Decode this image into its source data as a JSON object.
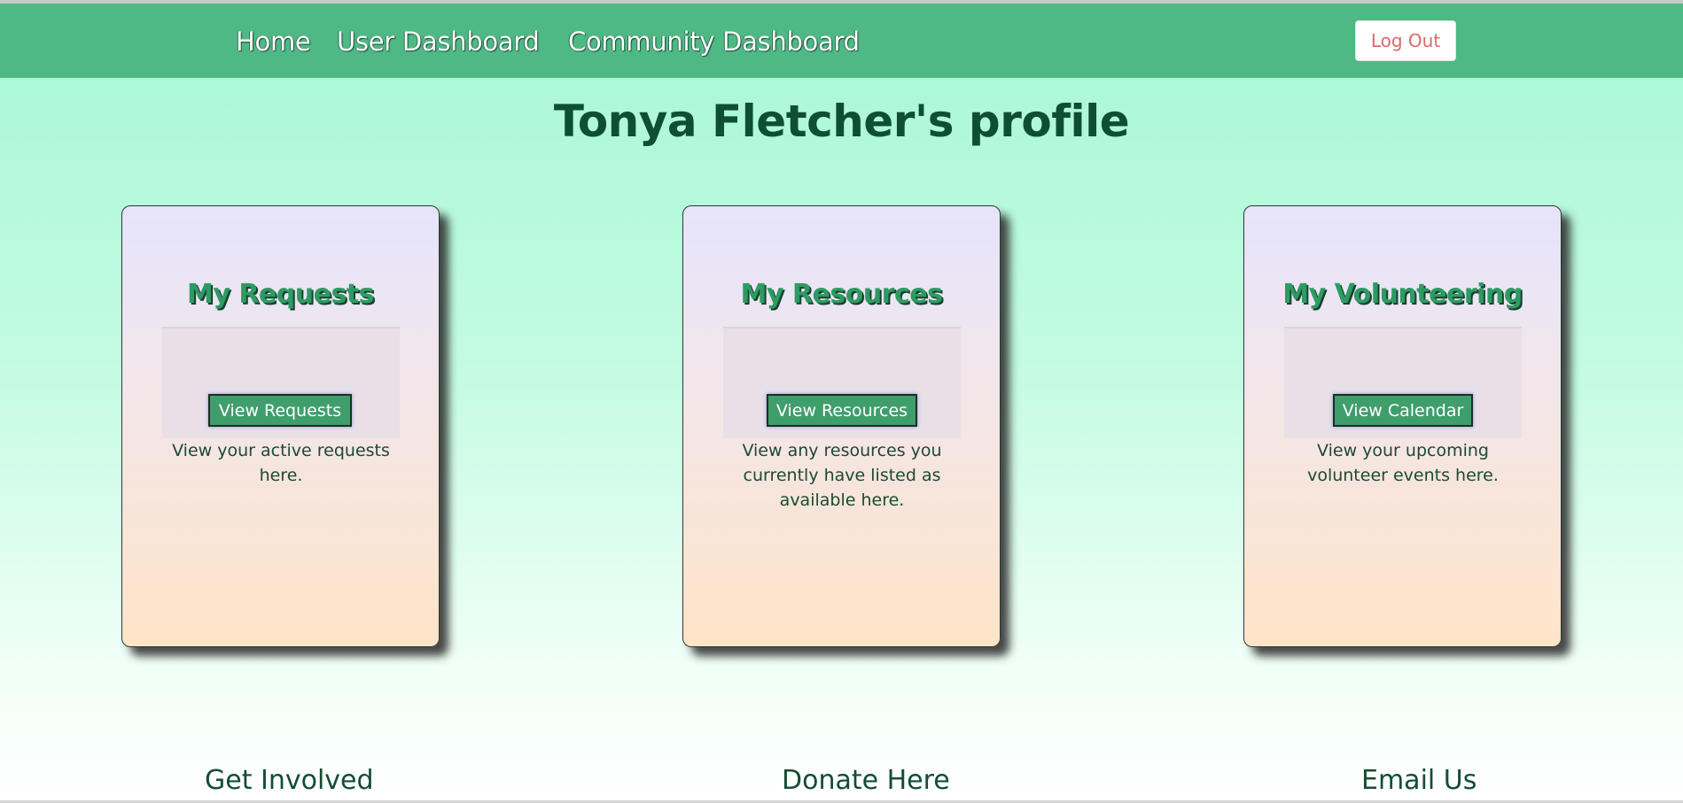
{
  "navbar": {
    "links": [
      "Home",
      "User Dashboard",
      "Community Dashboard"
    ],
    "logout_label": "Log Out",
    "background": "#4eb985"
  },
  "page_title": "Tonya Fletcher's profile",
  "cards": [
    {
      "title": "My Requests",
      "button": "View Requests",
      "description": "View your active requests here."
    },
    {
      "title": "My Resources",
      "button": "View Resources",
      "description": "View any resources you currently have listed as available here."
    },
    {
      "title": "My Volunteering",
      "button": "View Calendar",
      "description": "View your upcoming volunteer events here."
    }
  ],
  "footer": {
    "links": [
      "Get Involved",
      "Donate Here",
      "Email Us"
    ]
  },
  "colors": {
    "accent_green": "#4eb985",
    "title_text": "#0e4f33",
    "logout_text": "#d96a6a"
  }
}
